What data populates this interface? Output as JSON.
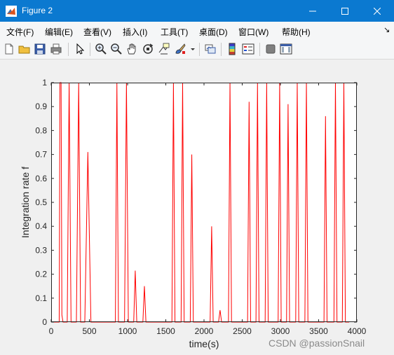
{
  "window": {
    "title": "Figure 2"
  },
  "menu": [
    "文件(F)",
    "编辑(E)",
    "查看(V)",
    "插入(I)",
    "工具(T)",
    "桌面(D)",
    "窗口(W)",
    "帮助(H)"
  ],
  "menu_overflow": "↘",
  "toolbar": [
    "new-figure-icon",
    "open-file-icon",
    "save-icon",
    "print-icon",
    "pointer-icon",
    "zoom-in-icon",
    "zoom-out-icon",
    "pan-icon",
    "rotate-3d-icon",
    "data-cursor-icon",
    "brush-icon",
    "link-plot-icon",
    "colorbar-icon",
    "legend-icon",
    "hide-plot-tools-icon",
    "show-plot-tools-icon"
  ],
  "chart_data": {
    "type": "line",
    "xlabel": "time(s)",
    "ylabel": "Integration rate f",
    "xlim": [
      0,
      4000
    ],
    "ylim": [
      0,
      1
    ],
    "xticks": [
      0,
      500,
      1000,
      1500,
      2000,
      2500,
      3000,
      3500,
      4000
    ],
    "yticks": [
      0,
      0.1,
      0.2,
      0.3,
      0.4,
      0.5,
      0.6,
      0.7,
      0.8,
      0.9,
      1
    ],
    "grid": false,
    "line_color": "#ff0000",
    "series": [
      {
        "x": [
          0,
          105,
          115,
          130,
          140,
          155,
          170,
          180,
          210,
          235,
          260,
          330,
          360,
          385,
          440,
          480,
          520,
          840,
          860,
          880,
          960,
          985,
          1010,
          1080,
          1100,
          1120,
          1200,
          1220,
          1240,
          1580,
          1600,
          1620,
          1700,
          1720,
          1740,
          1820,
          1840,
          1860,
          2080,
          2100,
          2120,
          2190,
          2210,
          2230,
          2320,
          2340,
          2360,
          2570,
          2590,
          2610,
          2680,
          2700,
          2720,
          2800,
          2820,
          2840,
          2970,
          2990,
          3010,
          3080,
          3100,
          3120,
          3200,
          3220,
          3240,
          3320,
          3340,
          3360,
          3570,
          3590,
          3610,
          3700,
          3720,
          3740,
          3810,
          3830,
          3850,
          3900
        ],
        "y": [
          0,
          0,
          1,
          1,
          0.03,
          0,
          0,
          0,
          0,
          1,
          0,
          0,
          1,
          0,
          0,
          0.71,
          0,
          0,
          1,
          0,
          0,
          1,
          0,
          0,
          0.215,
          0,
          0,
          0.15,
          0,
          0,
          1,
          0,
          0,
          1,
          0,
          0,
          0.7,
          0,
          0,
          0.4,
          0,
          0,
          0.05,
          0,
          0,
          1,
          0,
          0,
          0.92,
          0,
          0,
          1,
          0,
          0,
          1,
          0,
          0,
          1,
          0,
          0,
          0.91,
          0,
          0,
          1,
          0,
          0,
          1,
          0,
          0,
          0.86,
          0,
          0,
          1,
          0,
          0,
          1,
          0,
          0
        ]
      }
    ]
  },
  "watermark": "CSDN @passionSnail"
}
